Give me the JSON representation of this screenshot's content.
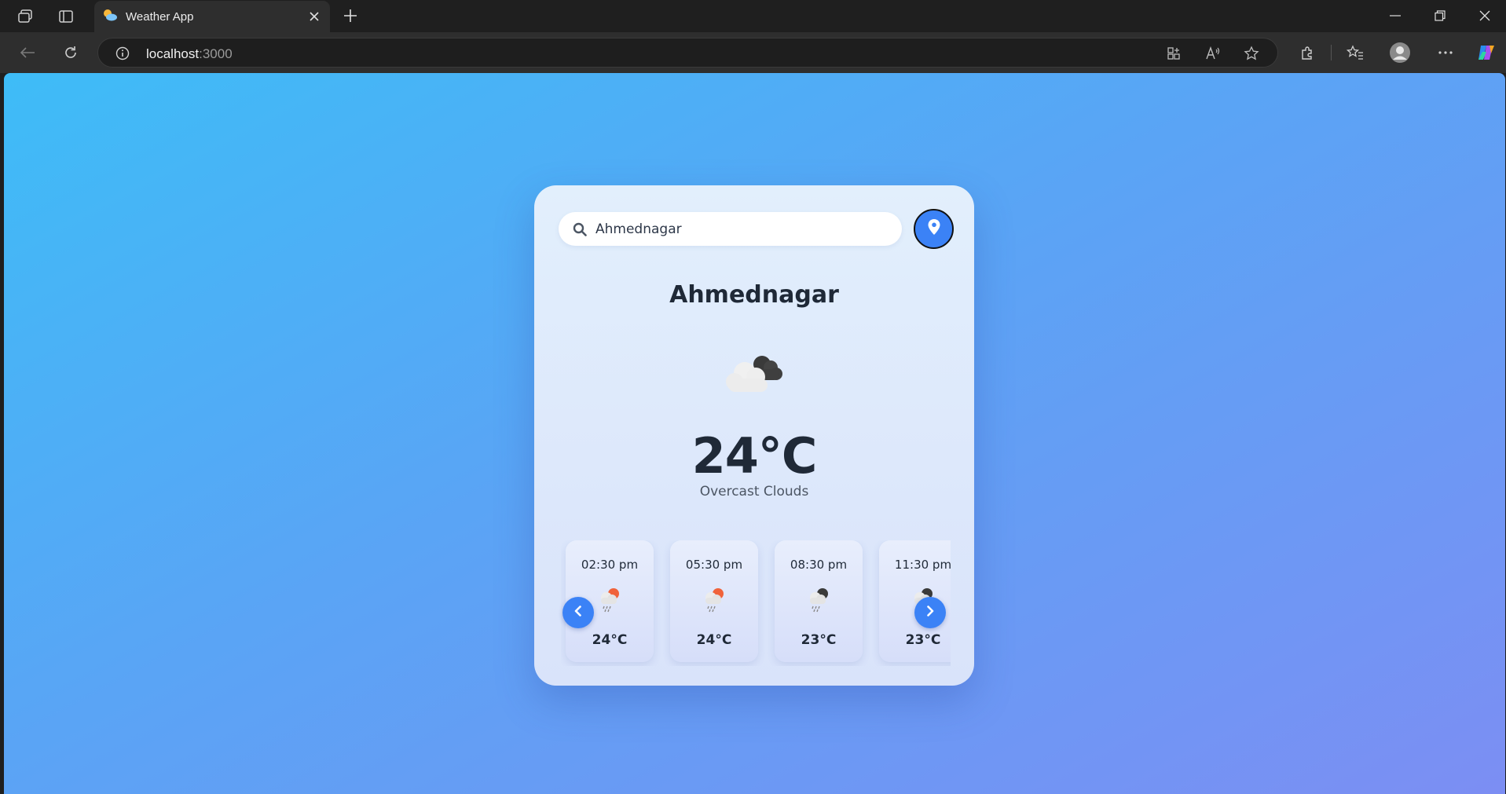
{
  "browser": {
    "tab_title": "Weather App",
    "url_host": "localhost",
    "url_port": ":3000"
  },
  "app": {
    "search": {
      "value": "Ahmednagar",
      "placeholder": ""
    },
    "city": "Ahmednagar",
    "current": {
      "temp": "24°C",
      "description": "Overcast Clouds",
      "icon": "overcast-clouds-icon"
    },
    "forecast": [
      {
        "time": "02:30 pm",
        "temp": "24°C",
        "icon": "rain-sun-icon"
      },
      {
        "time": "05:30 pm",
        "temp": "24°C",
        "icon": "rain-sun-icon"
      },
      {
        "time": "08:30 pm",
        "temp": "23°C",
        "icon": "rain-night-icon"
      },
      {
        "time": "11:30 pm",
        "temp": "23°C",
        "icon": "rain-night-icon"
      }
    ]
  },
  "colors": {
    "accent": "#3b82f6",
    "text_primary": "#1f2937",
    "text_secondary": "#4b5563",
    "background_start": "#3ebcf7",
    "background_end": "#7c8ef3"
  }
}
